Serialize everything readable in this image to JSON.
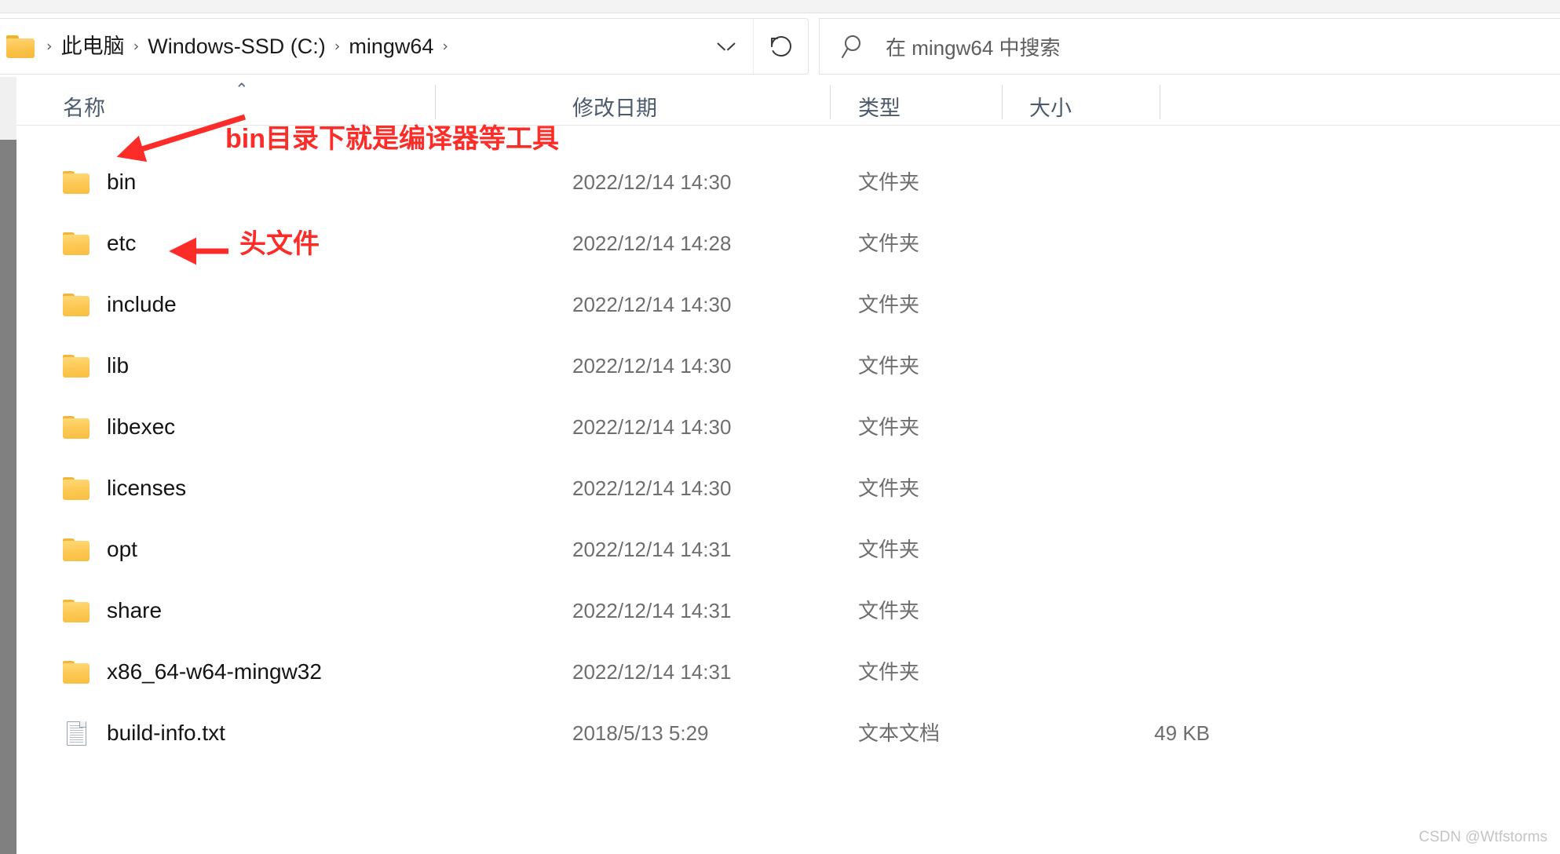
{
  "window": {
    "title": "mingw64"
  },
  "address_bar": {
    "folder_icon": "folder-icon",
    "breadcrumb": [
      {
        "label": "此电脑"
      },
      {
        "label": "Windows-SSD (C:)"
      },
      {
        "label": "mingw64"
      }
    ],
    "separator": "›",
    "dropdown_icon": "chevron-down-icon",
    "refresh_icon": "refresh-icon"
  },
  "search": {
    "icon": "search-icon",
    "placeholder": "在 mingw64 中搜索",
    "value": ""
  },
  "columns": [
    {
      "key": "name",
      "label": "名称",
      "sorted": true,
      "sort_caret": "⌃"
    },
    {
      "key": "date",
      "label": "修改日期"
    },
    {
      "key": "type",
      "label": "类型"
    },
    {
      "key": "size",
      "label": "大小"
    }
  ],
  "files": [
    {
      "name": "bin",
      "date": "2022/12/14 14:30",
      "type": "文件夹",
      "size": "",
      "icon": "folder-icon"
    },
    {
      "name": "etc",
      "date": "2022/12/14 14:28",
      "type": "文件夹",
      "size": "",
      "icon": "folder-icon"
    },
    {
      "name": "include",
      "date": "2022/12/14 14:30",
      "type": "文件夹",
      "size": "",
      "icon": "folder-icon"
    },
    {
      "name": "lib",
      "date": "2022/12/14 14:30",
      "type": "文件夹",
      "size": "",
      "icon": "folder-icon"
    },
    {
      "name": "libexec",
      "date": "2022/12/14 14:30",
      "type": "文件夹",
      "size": "",
      "icon": "folder-icon"
    },
    {
      "name": "licenses",
      "date": "2022/12/14 14:30",
      "type": "文件夹",
      "size": "",
      "icon": "folder-icon"
    },
    {
      "name": "opt",
      "date": "2022/12/14 14:31",
      "type": "文件夹",
      "size": "",
      "icon": "folder-icon"
    },
    {
      "name": "share",
      "date": "2022/12/14 14:31",
      "type": "文件夹",
      "size": "",
      "icon": "folder-icon"
    },
    {
      "name": "x86_64-w64-mingw32",
      "date": "2022/12/14 14:31",
      "type": "文件夹",
      "size": "",
      "icon": "folder-icon"
    },
    {
      "name": "build-info.txt",
      "date": "2018/5/13 5:29",
      "type": "文本文档",
      "size": "49 KB",
      "icon": "text-document-icon"
    }
  ],
  "annotations": [
    {
      "id": "bin-note",
      "text": "bin目录下就是编译器等工具",
      "arrow": "diagonal-arrow-left-down"
    },
    {
      "id": "include-note",
      "text": "头文件",
      "arrow": "horizontal-arrow-left"
    }
  ],
  "colors": {
    "annotation_red": "#fc2c28",
    "folder_yellow": "#fdc954",
    "header_text": "#4c5a6b",
    "secondary_text": "#6e6e6e",
    "scrollbar_thumb": "#808080"
  },
  "watermark": {
    "text": "CSDN @Wtfstorms"
  }
}
